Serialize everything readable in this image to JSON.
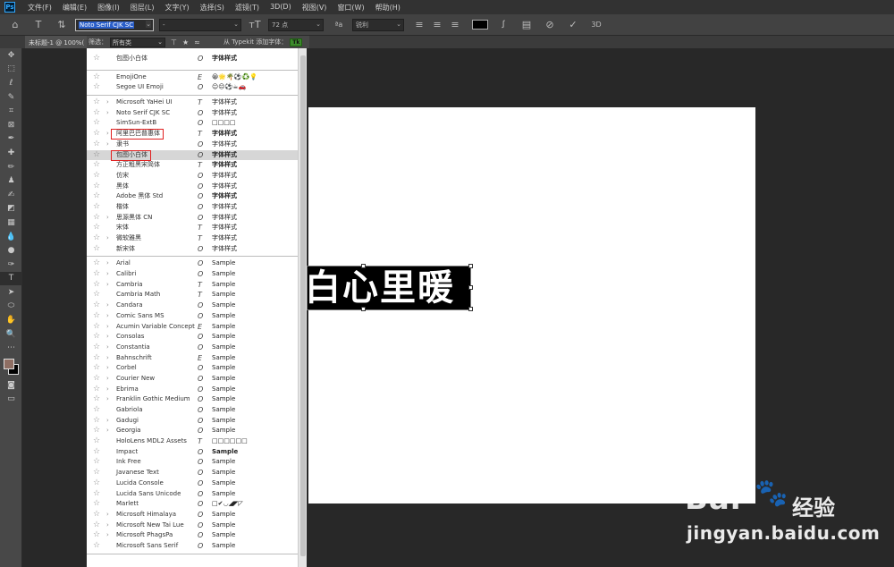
{
  "app": {
    "logo": "Ps",
    "menu": [
      "文件(F)",
      "编辑(E)",
      "图像(I)",
      "图层(L)",
      "文字(Y)",
      "选择(S)",
      "滤镜(T)",
      "3D(D)",
      "视图(V)",
      "窗口(W)",
      "帮助(H)"
    ]
  },
  "options_bar": {
    "font_family": "Noto Serif CJK SC",
    "font_style": "-",
    "font_size": "72 点",
    "antialias": "锐利",
    "text_color": "#000000",
    "tool_3d": "3D"
  },
  "doc_tab": {
    "title": "未标题-1 @ 100%("
  },
  "filter_bar": {
    "label": "筛选：",
    "filter_value": "所有类",
    "typekit_label": "从 Typekit 添加字体：",
    "typekit_badge": "Tk"
  },
  "font_groups": [
    {
      "rows": [
        {
          "name": "包图小白体",
          "type": "O",
          "sample": "字体样式",
          "bold": true
        }
      ]
    },
    {
      "rows": [
        {
          "name": "EmojiOne",
          "type": "E",
          "sample": "😀🌟🌴⚽♻️💡"
        },
        {
          "name": "Segoe UI Emoji",
          "type": "O",
          "sample": "☺☹⚽☕🚗"
        }
      ]
    },
    {
      "rows": [
        {
          "name": "Microsoft YaHei UI",
          "type": "T",
          "sample": "字体样式",
          "chev": true
        },
        {
          "name": "Noto Serif CJK SC",
          "type": "O",
          "sample": "字体样式",
          "chev": true
        },
        {
          "name": "SimSun-ExtB",
          "type": "O",
          "sample": "□□□□"
        },
        {
          "name": "阿里巴巴普惠体",
          "type": "T",
          "sample": "字体样式",
          "bold": true,
          "chev": true,
          "highlight": true
        },
        {
          "name": "隶书",
          "type": "O",
          "sample": "字体样式",
          "chev": true
        },
        {
          "name": "包图小白体",
          "type": "O",
          "sample": "字体样式",
          "bold": true,
          "highlight": true,
          "selected": true
        },
        {
          "name": "方正粗黑宋简体",
          "type": "T",
          "sample": "字体样式",
          "bold": true
        },
        {
          "name": "仿宋",
          "type": "O",
          "sample": "字体样式"
        },
        {
          "name": "黑体",
          "type": "O",
          "sample": "字体样式"
        },
        {
          "name": "Adobe 黑体 Std",
          "type": "O",
          "sample": "字体样式",
          "bold": true
        },
        {
          "name": "楷体",
          "type": "O",
          "sample": "字体样式"
        },
        {
          "name": "思源黑体 CN",
          "type": "O",
          "sample": "字体样式",
          "chev": true
        },
        {
          "name": "宋体",
          "type": "T",
          "sample": "字体样式"
        },
        {
          "name": "微软雅黑",
          "type": "T",
          "sample": "字体样式",
          "chev": true
        },
        {
          "name": "新宋体",
          "type": "O",
          "sample": "字体样式"
        }
      ]
    },
    {
      "rows": [
        {
          "name": "Arial",
          "type": "O",
          "sample": "Sample",
          "chev": true
        },
        {
          "name": "Calibri",
          "type": "O",
          "sample": "Sample",
          "chev": true
        },
        {
          "name": "Cambria",
          "type": "T",
          "sample": "Sample",
          "chev": true
        },
        {
          "name": "Cambria Math",
          "type": "T",
          "sample": "Sample"
        },
        {
          "name": "Candara",
          "type": "O",
          "sample": "Sample",
          "chev": true
        },
        {
          "name": "Comic Sans MS",
          "type": "O",
          "sample": "Sample",
          "chev": true
        },
        {
          "name": "Acumin Variable Concept",
          "type": "E",
          "sample": "Sample",
          "chev": true
        },
        {
          "name": "Consolas",
          "type": "O",
          "sample": "Sample",
          "chev": true
        },
        {
          "name": "Constantia",
          "type": "O",
          "sample": "Sample",
          "chev": true
        },
        {
          "name": "Bahnschrift",
          "type": "E",
          "sample": "Sample",
          "chev": true
        },
        {
          "name": "Corbel",
          "type": "O",
          "sample": "Sample",
          "chev": true
        },
        {
          "name": "Courier New",
          "type": "O",
          "sample": "Sample",
          "chev": true
        },
        {
          "name": "Ebrima",
          "type": "O",
          "sample": "Sample",
          "chev": true
        },
        {
          "name": "Franklin Gothic Medium",
          "type": "O",
          "sample": "Sample",
          "chev": true
        },
        {
          "name": "Gabriola",
          "type": "O",
          "sample": "Sample"
        },
        {
          "name": "Gadugi",
          "type": "O",
          "sample": "Sample",
          "chev": true
        },
        {
          "name": "Georgia",
          "type": "O",
          "sample": "Sample",
          "chev": true
        },
        {
          "name": "HoloLens MDL2 Assets",
          "type": "T",
          "sample": "□□□□□□"
        },
        {
          "name": "Impact",
          "type": "O",
          "sample": "Sample",
          "bold": true
        },
        {
          "name": "Ink Free",
          "type": "O",
          "sample": "Sample"
        },
        {
          "name": "Javanese Text",
          "type": "O",
          "sample": "Sample"
        },
        {
          "name": "Lucida Console",
          "type": "O",
          "sample": "Sample"
        },
        {
          "name": "Lucida Sans Unicode",
          "type": "O",
          "sample": "Sample"
        },
        {
          "name": "Marlett",
          "type": "O",
          "sample": "□✔◡◢◤◸"
        },
        {
          "name": "Microsoft Himalaya",
          "type": "O",
          "sample": "Sample",
          "chev": true
        },
        {
          "name": "Microsoft New Tai Lue",
          "type": "O",
          "sample": "Sample",
          "chev": true
        },
        {
          "name": "Microsoft PhagsPa",
          "type": "O",
          "sample": "Sample",
          "chev": true
        },
        {
          "name": "Microsoft Sans Serif",
          "type": "O",
          "sample": "Sample"
        }
      ]
    }
  ],
  "canvas": {
    "text": "白心里暖",
    "doc_color": "#ffffff",
    "text_bg": "#000000"
  },
  "watermark": {
    "brand": "Bai",
    "brand_cn": "经验",
    "url": "jingyan.baidu.com"
  }
}
